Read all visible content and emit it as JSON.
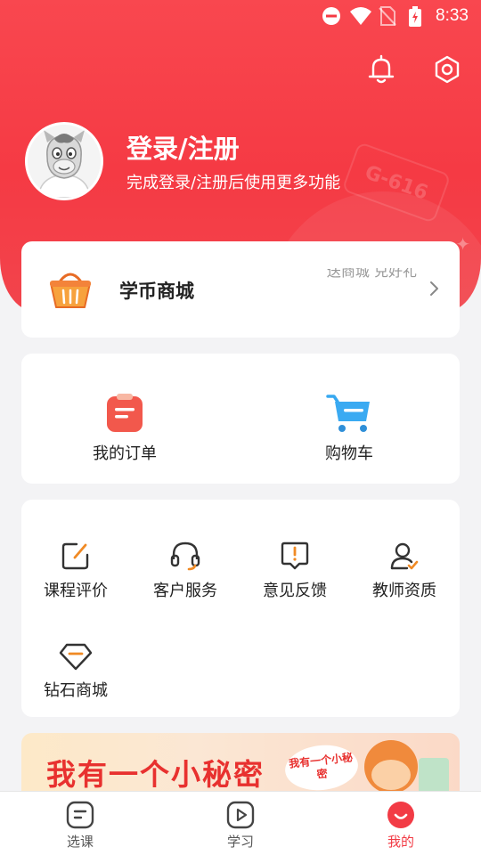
{
  "status_bar": {
    "time": "8:33"
  },
  "profile": {
    "title": "登录/注册",
    "subtitle": "完成登录/注册后使用更多功能"
  },
  "mall": {
    "label": "学币商城",
    "hint": "送商城 兑好礼"
  },
  "orders": [
    {
      "label": "我的订单",
      "icon": "order-icon"
    },
    {
      "label": "购物车",
      "icon": "cart-icon"
    }
  ],
  "services": [
    {
      "label": "课程评价",
      "icon": "edit-icon"
    },
    {
      "label": "客户服务",
      "icon": "headset-icon"
    },
    {
      "label": "意见反馈",
      "icon": "feedback-icon"
    },
    {
      "label": "教师资质",
      "icon": "teacher-icon"
    },
    {
      "label": "钻石商城",
      "icon": "diamond-icon"
    }
  ],
  "banner": {
    "text": "我有一个小秘密",
    "bubble": "我有一个小秘密"
  },
  "tabs": [
    {
      "label": "选课",
      "icon": "course-icon",
      "active": false
    },
    {
      "label": "学习",
      "icon": "play-icon",
      "active": false
    },
    {
      "label": "我的",
      "icon": "profile-icon",
      "active": true
    }
  ],
  "colors": {
    "accent": "#f53a44",
    "background": "#f3f3f5"
  }
}
